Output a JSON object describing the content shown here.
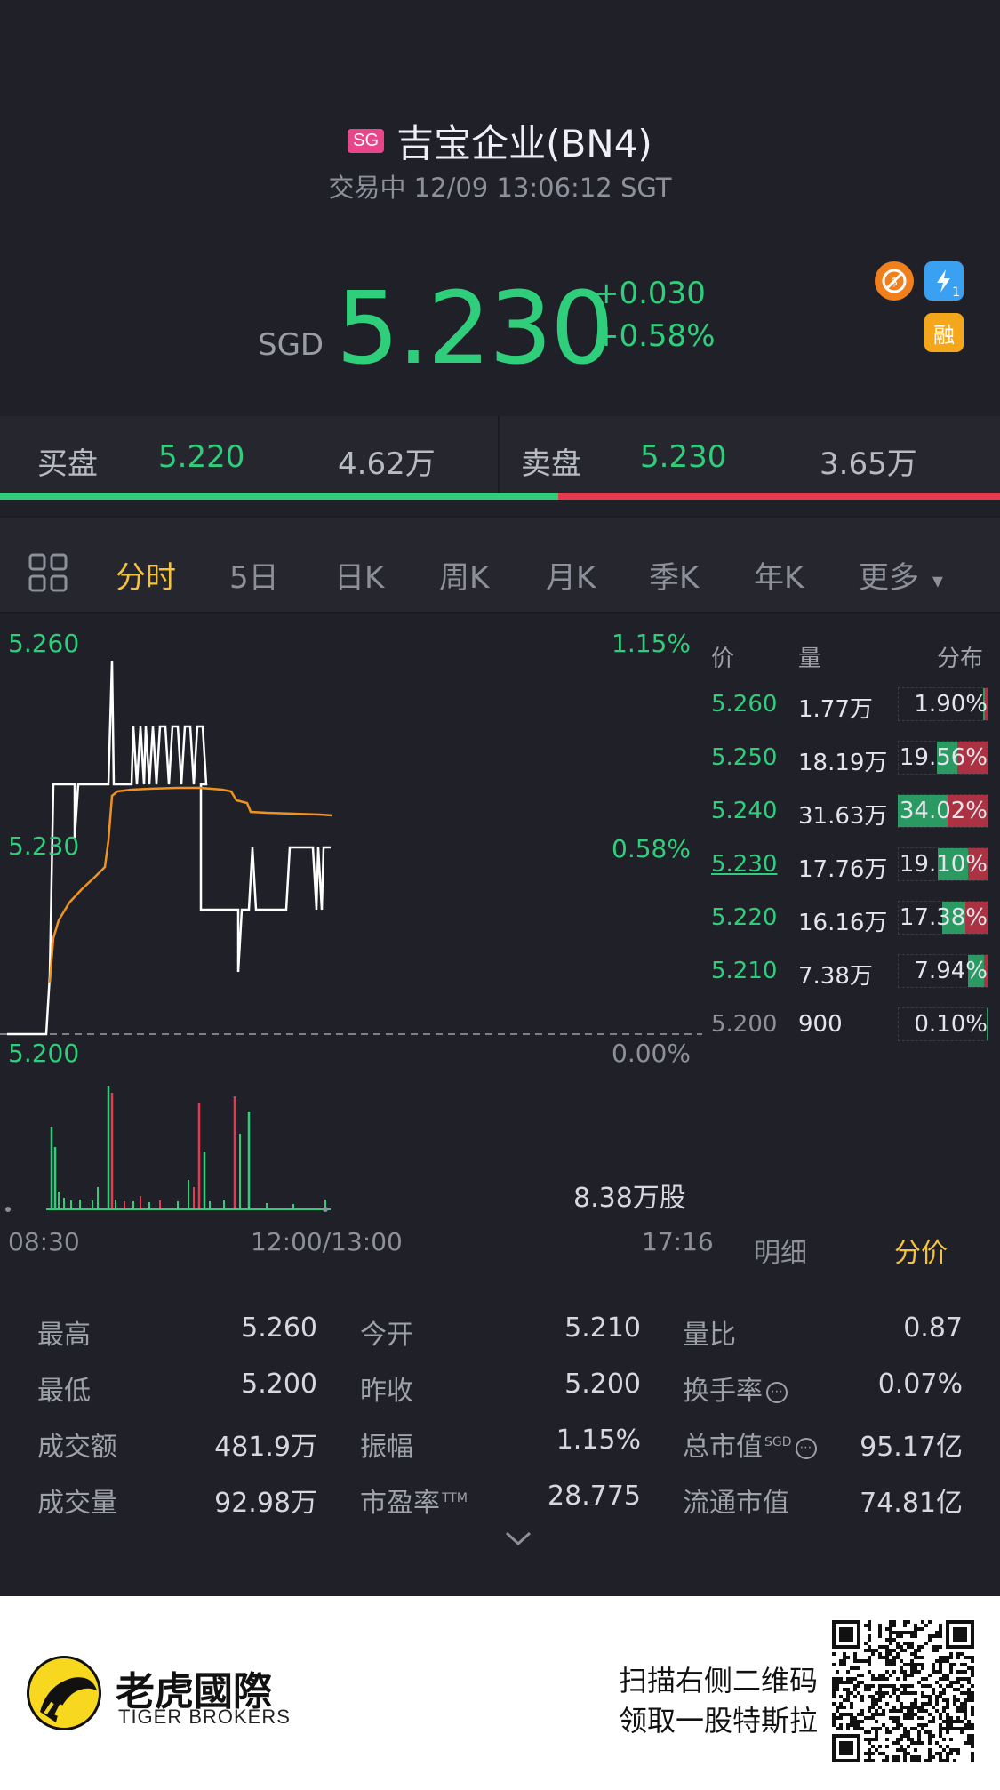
{
  "header": {
    "market_badge": "SG",
    "title": "吉宝企业(BN4)",
    "subtitle": "交易中 12/09 13:06:12 SGT",
    "currency": "SGD",
    "price": "5.230",
    "change": "+0.030",
    "change_pct": "+0.58%",
    "icons": [
      "no-shortsell-icon",
      "lightning-icon",
      "margin-icon"
    ],
    "margin_label": "融",
    "lightning_sub": "1"
  },
  "bidask": {
    "bid_label": "买盘",
    "bid_price": "5.220",
    "bid_volume": "4.62万",
    "ask_label": "卖盘",
    "ask_price": "5.230",
    "ask_volume": "3.65万",
    "bid_fraction": 0.558
  },
  "tabs": {
    "items": [
      "分时",
      "5日",
      "日K",
      "周K",
      "月K",
      "季K",
      "年K",
      "更多"
    ],
    "active": "分时",
    "more_caret": "▾"
  },
  "chart": {
    "y_high": "5.260",
    "y_mid": "5.230",
    "y_low": "5.200",
    "pct_high": "1.15%",
    "pct_mid": "0.58%",
    "pct_low": "0.00%",
    "x_start": "08:30",
    "x_mid": "12:00/13:00",
    "x_end": "17:16",
    "volume_label": "8.38万股",
    "tab_detail": "明细",
    "tab_price": "分价"
  },
  "distribution": {
    "headers": [
      "价",
      "量",
      "分布"
    ],
    "rows": [
      {
        "price": "5.260",
        "vol": "1.77万",
        "pct": "1.90%",
        "buy": 0.3,
        "sell": 0.7,
        "size": 0.06
      },
      {
        "price": "5.250",
        "vol": "18.19万",
        "pct": "19.56%",
        "buy": 0.4,
        "sell": 0.6,
        "size": 0.57
      },
      {
        "price": "5.240",
        "vol": "31.63万",
        "pct": "34.02%",
        "buy": 0.55,
        "sell": 0.45,
        "size": 1.0
      },
      {
        "price": "5.230",
        "vol": "17.76万",
        "pct": "19.10%",
        "buy": 0.6,
        "sell": 0.4,
        "size": 0.56
      },
      {
        "price": "5.220",
        "vol": "16.16万",
        "pct": "17.38%",
        "buy": 0.5,
        "sell": 0.5,
        "size": 0.51
      },
      {
        "price": "5.210",
        "vol": "7.38万",
        "pct": "7.94%",
        "buy": 0.8,
        "sell": 0.2,
        "size": 0.23
      },
      {
        "price": "5.200",
        "vol": "900",
        "pct": "0.10%",
        "buy": 0.5,
        "sell": 0.5,
        "size": 0.0
      }
    ]
  },
  "stats": {
    "col1": [
      {
        "label": "最高",
        "value": "5.260"
      },
      {
        "label": "最低",
        "value": "5.200"
      },
      {
        "label": "成交额",
        "value": "481.9万"
      },
      {
        "label": "成交量",
        "value": "92.98万"
      }
    ],
    "col2": [
      {
        "label": "今开",
        "value": "5.210"
      },
      {
        "label": "昨收",
        "value": "5.200"
      },
      {
        "label": "振幅",
        "value": "1.15%"
      },
      {
        "label": "市盈率",
        "value": "28.775",
        "sup": "TTM"
      }
    ],
    "col3": [
      {
        "label": "量比",
        "value": "0.87"
      },
      {
        "label": "换手率",
        "value": "0.07%"
      },
      {
        "label": "总市值",
        "value": "95.17亿",
        "sup": "SGD"
      },
      {
        "label": "流通市值",
        "value": "74.81亿"
      }
    ],
    "expand_icon": "chevron-down-icon"
  },
  "footer": {
    "brand_cn": "老虎國際",
    "brand_en": "TIGER BROKERS",
    "promo_line1": "扫描右侧二维码",
    "promo_line2": "领取一股特斯拉"
  },
  "colors": {
    "up": "#2fce7b",
    "down": "#e5394f",
    "accent": "#f5c23b",
    "background": "#1f2028",
    "avg_line": "#f0931e"
  }
}
